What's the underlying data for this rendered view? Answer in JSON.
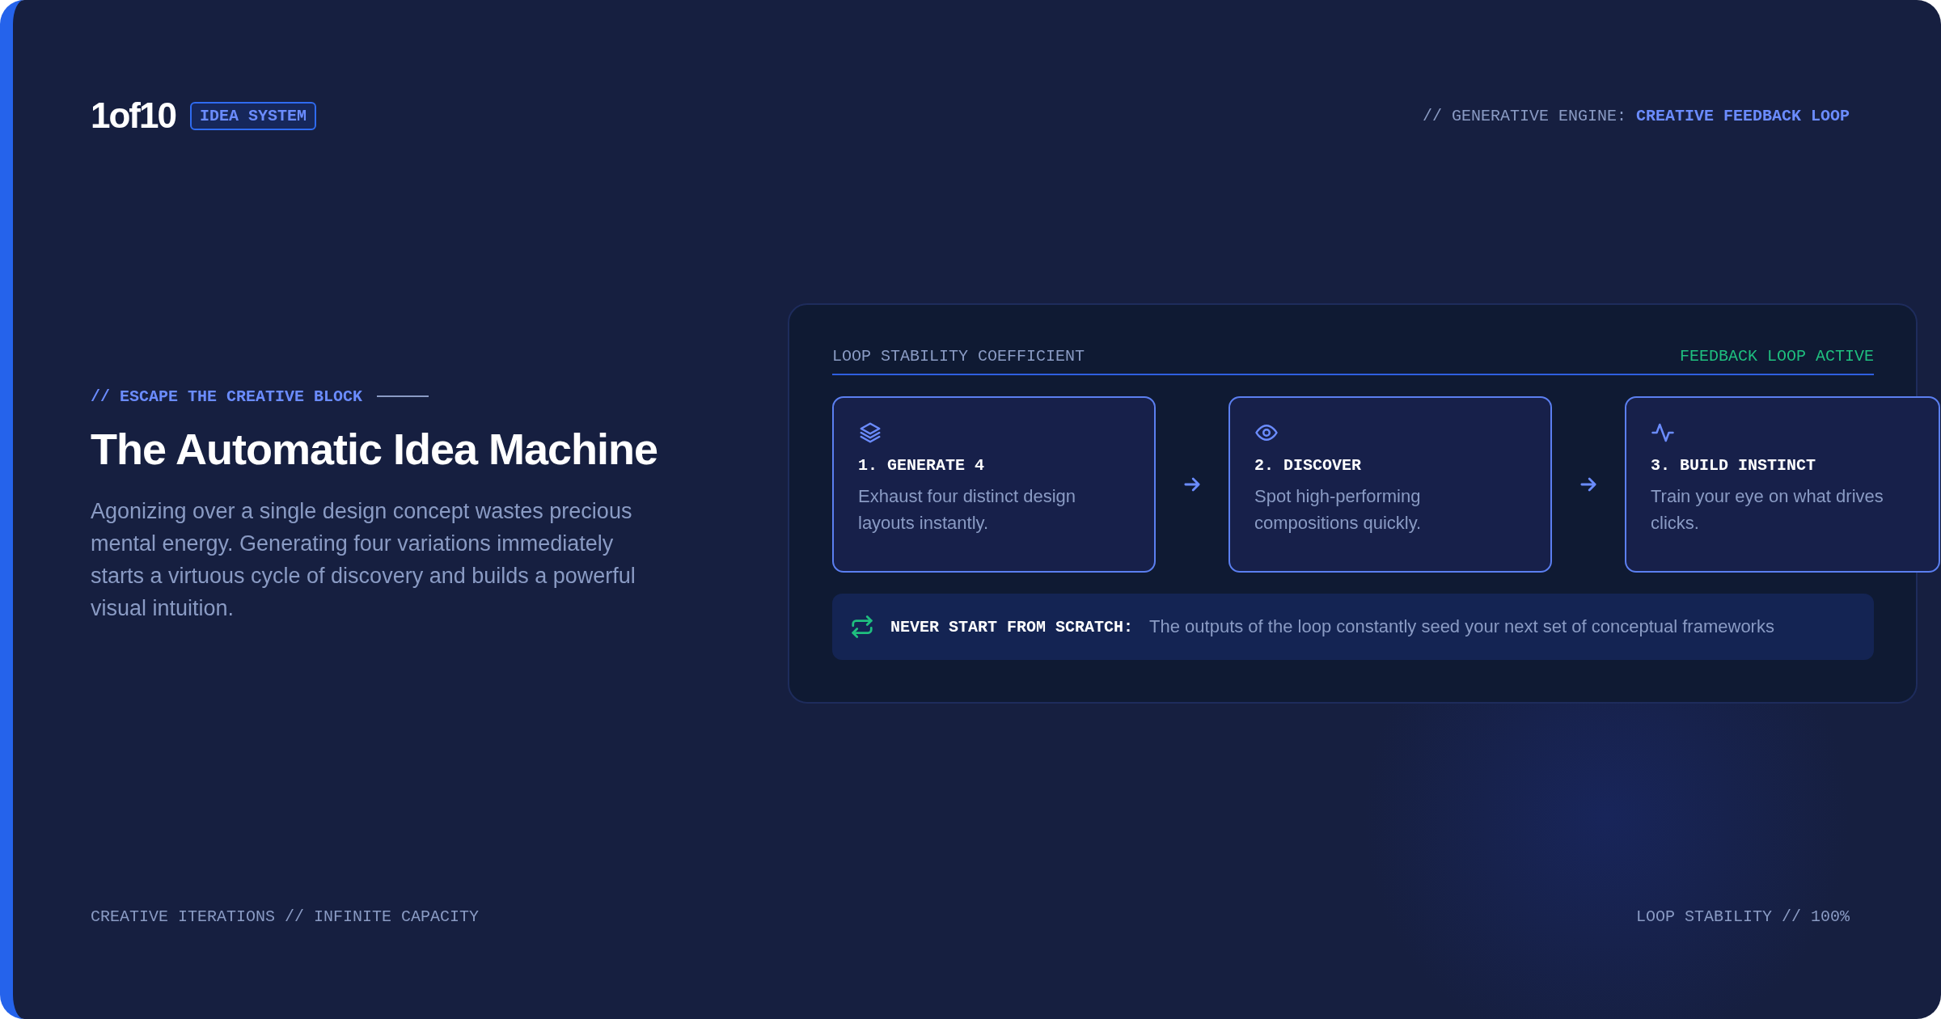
{
  "header": {
    "logo": "1of10",
    "badge": "IDEA SYSTEM",
    "engine_label": "// GENERATIVE ENGINE:",
    "engine_value": "CREATIVE FEEDBACK LOOP"
  },
  "intro": {
    "eyebrow": "// ESCAPE THE CREATIVE BLOCK",
    "title": "The Automatic Idea Machine",
    "body": "Agonizing over a single design concept wastes precious mental energy. Generating four variations immediately starts a virtuous cycle of discovery and builds a powerful visual intuition."
  },
  "panel": {
    "label": "LOOP STABILITY COEFFICIENT",
    "status": "FEEDBACK LOOP ACTIVE",
    "steps": [
      {
        "title": "1. GENERATE 4",
        "text": "Exhaust four distinct design layouts instantly."
      },
      {
        "title": "2. DISCOVER",
        "text": "Spot high-performing compositions quickly."
      },
      {
        "title": "3. BUILD INSTINCT",
        "text": "Train your eye on what drives clicks."
      }
    ],
    "callout": {
      "label": "NEVER START FROM SCRATCH:",
      "text": "The outputs of the loop constantly seed your next set of conceptual frameworks"
    }
  },
  "footer": {
    "left": "CREATIVE ITERATIONS // INFINITE CAPACITY",
    "right": "LOOP STABILITY // 100%"
  }
}
